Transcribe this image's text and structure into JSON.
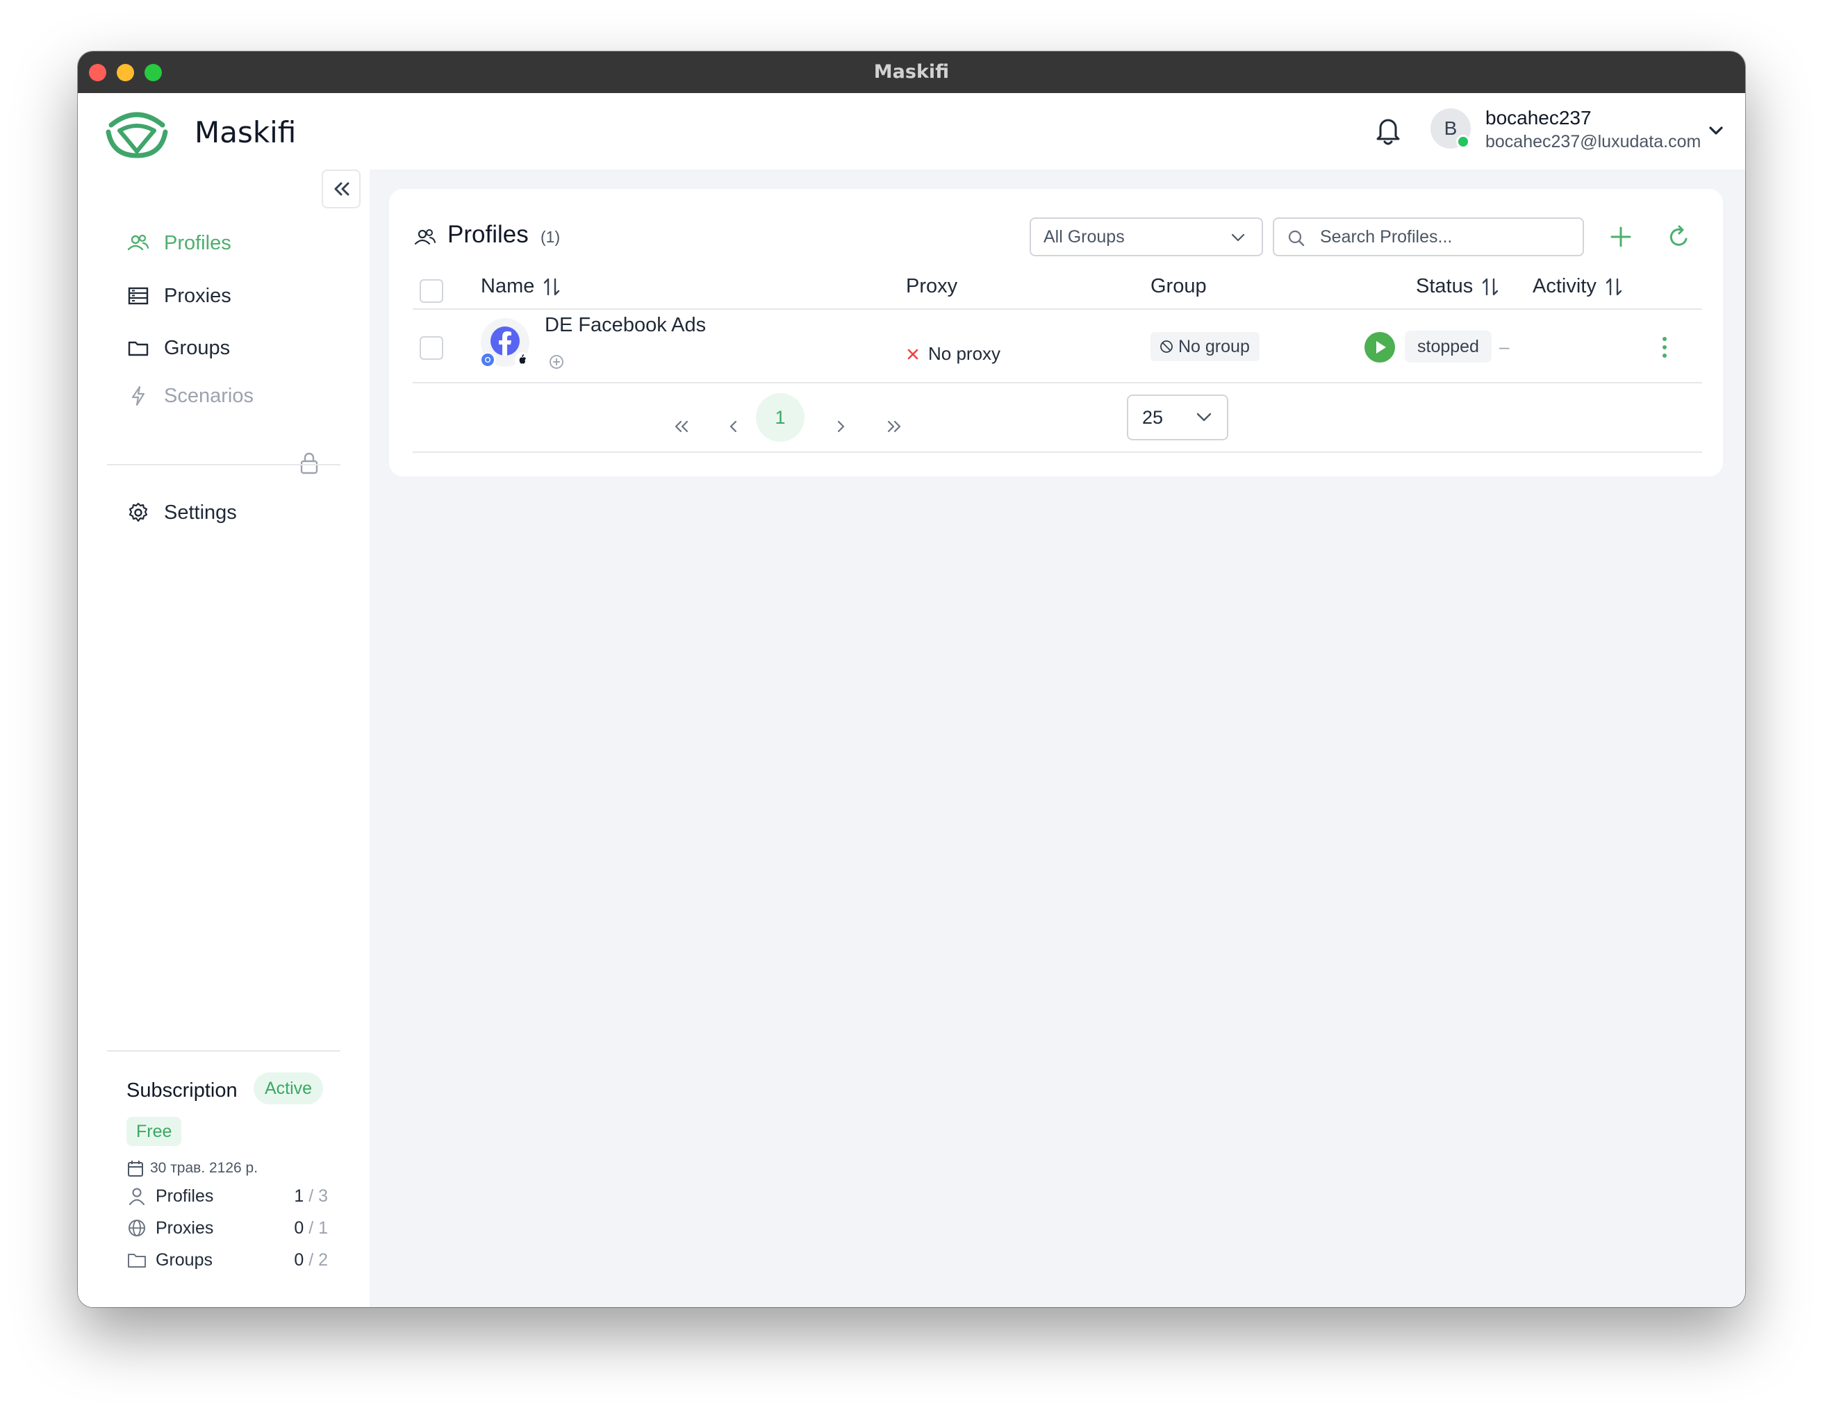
{
  "window": {
    "title": "Maskifi"
  },
  "header": {
    "brand": "Maskifi",
    "user": {
      "initial": "B",
      "name": "bocahec237",
      "email": "bocahec237@luxudata.com"
    }
  },
  "sidebar": {
    "items": [
      {
        "label": "Profiles",
        "icon": "users-icon",
        "active": true
      },
      {
        "label": "Proxies",
        "icon": "server-icon"
      },
      {
        "label": "Groups",
        "icon": "folder-icon"
      },
      {
        "label": "Scenarios",
        "icon": "bolt-icon",
        "locked": true
      },
      {
        "label": "Settings",
        "icon": "gear-icon"
      }
    ],
    "subscription": {
      "title": "Subscription",
      "status": "Active",
      "plan": "Free",
      "date": "30 трав. 2126 р.",
      "quotas": [
        {
          "label": "Profiles",
          "used": "1",
          "limit": "/ 3",
          "icon": "user-icon"
        },
        {
          "label": "Proxies",
          "used": "0",
          "limit": "/ 1",
          "icon": "globe-icon"
        },
        {
          "label": "Groups",
          "used": "0",
          "limit": "/ 2",
          "icon": "folder-icon"
        }
      ]
    }
  },
  "main": {
    "title": "Profiles",
    "count": "(1)",
    "group_filter": "All Groups",
    "search_placeholder": "Search Profiles...",
    "columns": {
      "name": "Name",
      "proxy": "Proxy",
      "group": "Group",
      "status": "Status",
      "activity": "Activity"
    },
    "rows": [
      {
        "name": "DE Facebook Ads",
        "proxy": "No proxy",
        "group": "No group",
        "status": "stopped",
        "activity": "–"
      }
    ],
    "pagination": {
      "current_page": "1",
      "page_size": "25"
    }
  },
  "colors": {
    "accent": "#4caf6e",
    "play": "#4caf50",
    "error": "#ef4444"
  }
}
